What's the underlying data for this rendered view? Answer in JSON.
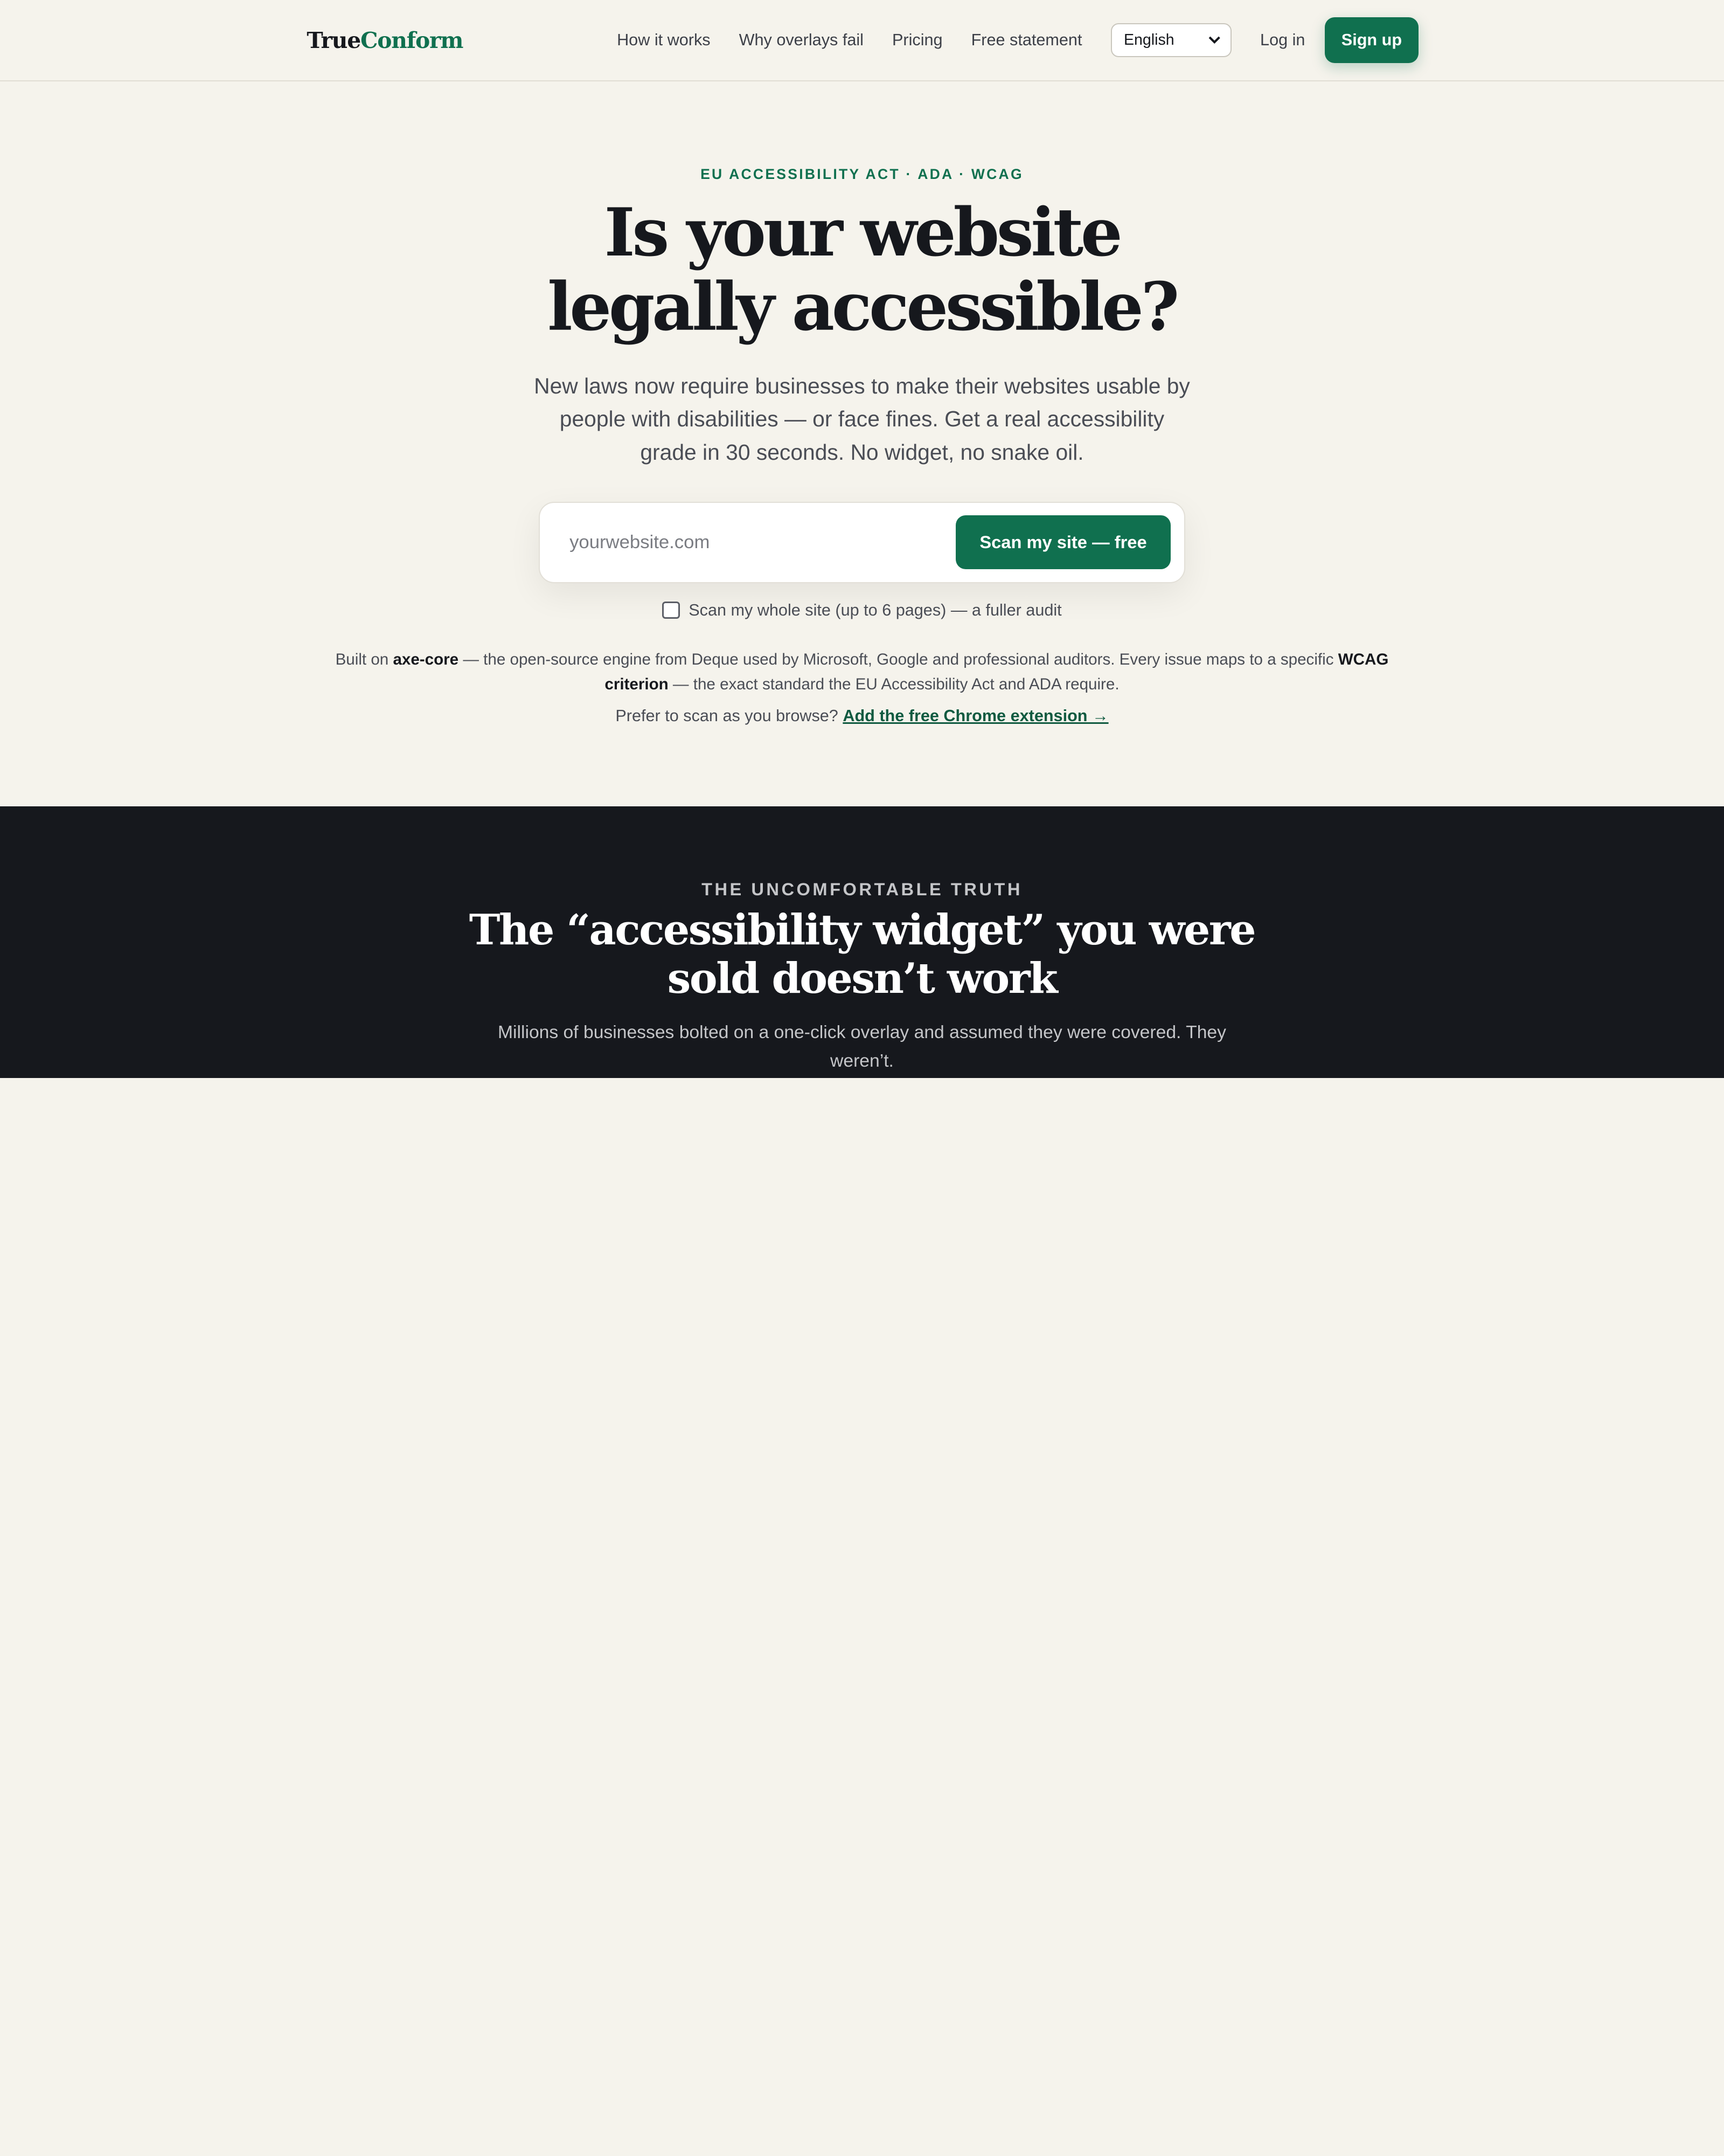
{
  "header": {
    "logo_part1": "True",
    "logo_part2": "Conform",
    "nav": {
      "how_it_works": "How it works",
      "why_overlays_fail": "Why overlays fail",
      "pricing": "Pricing",
      "free_statement": "Free statement"
    },
    "language": "English",
    "login": "Log in",
    "signup": "Sign up"
  },
  "hero": {
    "eyebrow": "EU ACCESSIBILITY ACT · ADA · WCAG",
    "title": "Is your website legally accessible?",
    "subtitle": "New laws now require businesses to make their websites usable by people with disabilities — or face fines. Get a real accessibility grade in 30 seconds. No widget, no snake oil.",
    "input_placeholder": "yourwebsite.com",
    "scan_button": "Scan my site — free",
    "whole_site_label": "Scan my whole site (up to 6 pages) — a fuller audit",
    "built_on": {
      "t1": "Built on ",
      "b1": "axe-core",
      "t2": " — the open-source engine from Deque used by Microsoft, Google and professional auditors. Every issue maps to a specific ",
      "b2": "WCAG criterion",
      "t3": " — the exact standard the EU Accessibility Act and ADA require."
    },
    "prefer_text": "Prefer to scan as you browse? ",
    "extension_link": "Add the free Chrome extension →"
  },
  "truth": {
    "eyebrow": "THE UNCOMFORTABLE TRUTH",
    "title": "The “accessibility widget” you were sold doesn’t work",
    "subtitle": "Millions of businesses bolted on a one-click overlay and assumed they were covered. They weren’t."
  },
  "colors": {
    "brand_green": "#10704f",
    "background": "#f5f3ec",
    "dark": "#16181d"
  }
}
